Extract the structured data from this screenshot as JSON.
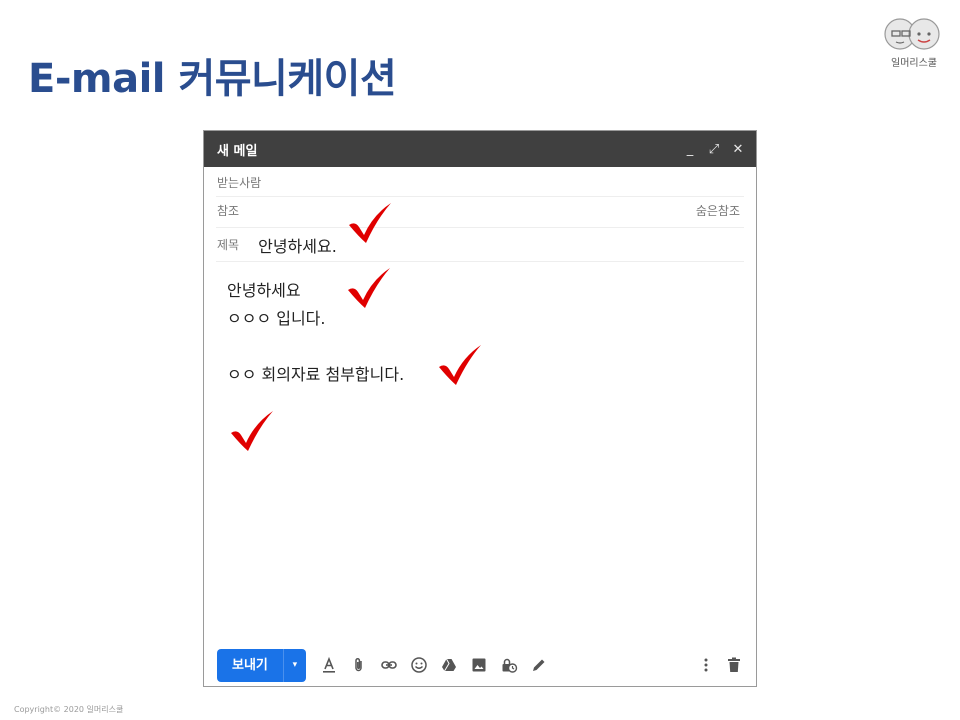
{
  "slide": {
    "title": "E-mail 커뮤니케이션",
    "logo_text": "일머리스쿨",
    "copyright": "Copyright© 2020 일머리스쿨"
  },
  "compose": {
    "window_title": "새 메일",
    "window_controls": [
      "_",
      "⤢",
      "✕"
    ],
    "to_label": "받는사람",
    "cc_label": "참조",
    "bcc_label": "숨은참조",
    "subject_label": "제목",
    "subject_value": "안녕하세요.",
    "body_lines": [
      "안녕하세요",
      "ㅇㅇㅇ 입니다.",
      "",
      "ㅇㅇ 회의자료 첨부합니다."
    ],
    "send_label": "보내기",
    "send_dropdown": "▾",
    "toolbar_icons": [
      "format-text-icon",
      "attach-icon",
      "link-icon",
      "emoji-icon",
      "drive-icon",
      "photo-icon",
      "confidential-icon",
      "signature-icon"
    ],
    "more_icon": "more-vert-icon",
    "trash_icon": "trash-icon"
  },
  "colors": {
    "title_blue": "#2a4d8f",
    "titlebar": "#404040",
    "send_blue": "#1a73e8",
    "check_red": "#e00000"
  }
}
